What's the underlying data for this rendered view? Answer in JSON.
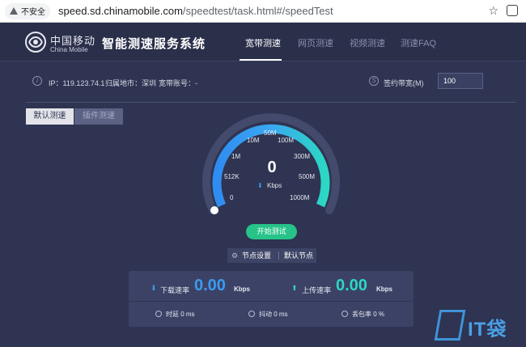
{
  "browser": {
    "security_label": "不安全",
    "url_host": "speed.sd.chinamobile.com",
    "url_path": "/speedtest/task.html#/speedTest"
  },
  "header": {
    "logo_cn": "中国移动",
    "logo_en": "China Mobile",
    "title": "智能测速服务系统",
    "nav": [
      "宽带测速",
      "网页测速",
      "视频测速",
      "测速FAQ"
    ],
    "active_nav": "宽带测速"
  },
  "info": {
    "ip": "IP：119.123.74.1",
    "location": "归属地市：深圳",
    "account": "宽带账号：-",
    "contract_label": "签约带宽(M)",
    "contract_value": "100"
  },
  "modes": {
    "default_label": "默认测速",
    "plugin_label": "插件测速"
  },
  "gauge": {
    "scale": [
      "0",
      "512K",
      "1M",
      "10M",
      "50M",
      "100M",
      "300M",
      "500M",
      "1000M"
    ],
    "value": "0",
    "unit": "Kbps",
    "needle_position": 0
  },
  "actions": {
    "start_label": "开始测试",
    "node_settings": "节点设置",
    "default_node": "默认节点"
  },
  "results": {
    "download_label": "下载速率",
    "download_value": "0.00",
    "download_unit": "Kbps",
    "upload_label": "上传速率",
    "upload_value": "0.00",
    "upload_unit": "Kbps",
    "latency": "时延  0 ms",
    "jitter": "抖动  0 ms",
    "loss": "丢包率  0 %"
  },
  "watermark": "IT袋",
  "colors": {
    "background": "#2e3451",
    "accent_blue": "#3a9bf0",
    "accent_teal": "#2cd7c3",
    "start_green": "#27c389"
  },
  "icons": [
    "warning-icon",
    "star-icon",
    "extension-icon",
    "china-mobile-logo",
    "info-icon",
    "bandwidth-icon",
    "download-icon",
    "upload-icon",
    "clock-icon",
    "jitter-icon",
    "loss-icon",
    "node-settings-icon"
  ]
}
